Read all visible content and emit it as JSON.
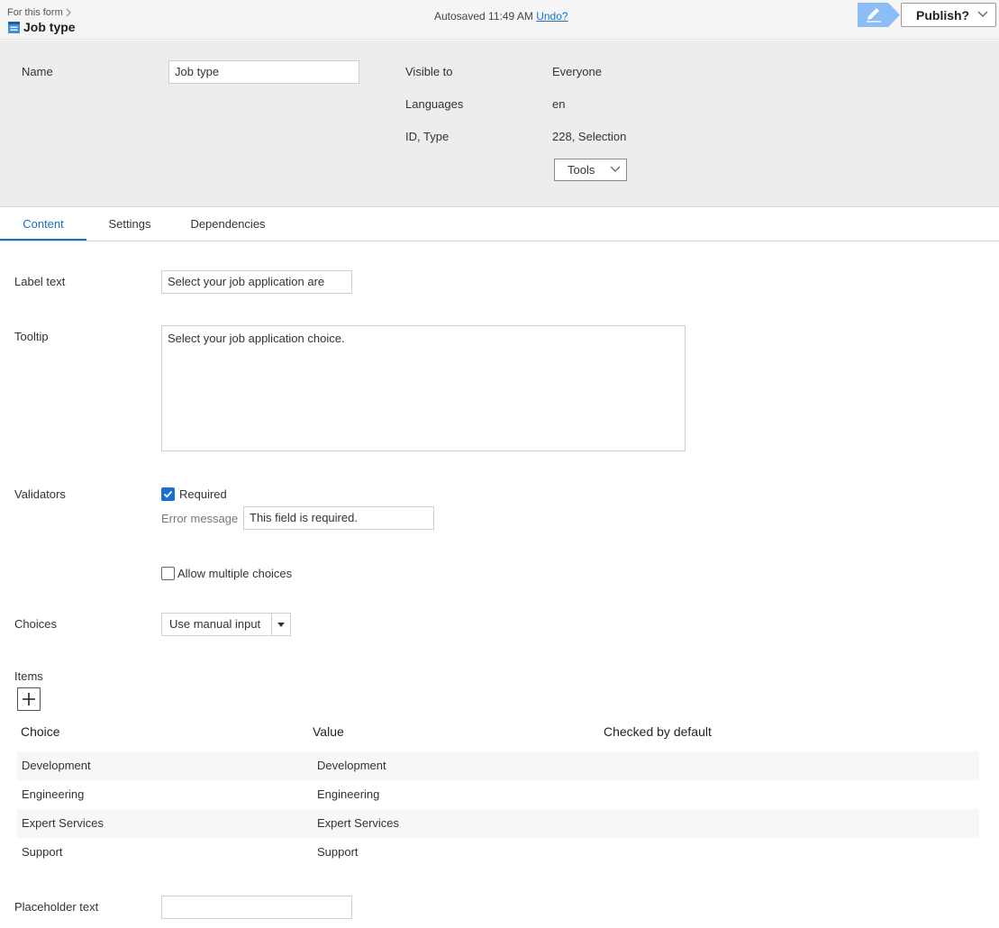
{
  "topbar": {
    "breadcrumb": "For this form",
    "title": "Job type",
    "autosave_text": "Autosaved 11:49 AM",
    "undo_label": "Undo?",
    "publish_label": "Publish?"
  },
  "properties": {
    "name_label": "Name",
    "name_value": "Job type",
    "visible_to_label": "Visible to",
    "visible_to_value": "Everyone",
    "languages_label": "Languages",
    "languages_value": "en",
    "id_type_label": "ID, Type",
    "id_type_value": "228, Selection",
    "tools_label": "Tools"
  },
  "tabs": [
    {
      "label": "Content",
      "active": true
    },
    {
      "label": "Settings",
      "active": false
    },
    {
      "label": "Dependencies",
      "active": false
    }
  ],
  "content": {
    "label_text_label": "Label text",
    "label_text_value": "Select your job application are",
    "tooltip_label": "Tooltip",
    "tooltip_value": "Select your job application choice.",
    "validators_label": "Validators",
    "required_label": "Required",
    "required_checked": true,
    "error_message_label": "Error message",
    "error_message_value": "This field is required.",
    "allow_multiple_label": "Allow multiple choices",
    "allow_multiple_checked": false,
    "choices_label": "Choices",
    "choices_value": "Use manual input",
    "items_label": "Items",
    "placeholder_label": "Placeholder text",
    "placeholder_value": ""
  },
  "items_table": {
    "headers": [
      "Choice",
      "Value",
      "Checked by default"
    ],
    "rows": [
      {
        "choice": "Development",
        "value": "Development"
      },
      {
        "choice": "Engineering",
        "value": "Engineering"
      },
      {
        "choice": "Expert Services",
        "value": "Expert Services"
      },
      {
        "choice": "Support",
        "value": "Support"
      }
    ]
  },
  "colors": {
    "accent": "#1a6fbf",
    "checkbox": "#1a6fd4",
    "edit_button": "#8cbef5"
  },
  "icons": [
    "form-block-icon",
    "chevron-right-icon",
    "pencil-icon",
    "chevron-down-icon",
    "checkmark-icon",
    "plus-icon"
  ]
}
